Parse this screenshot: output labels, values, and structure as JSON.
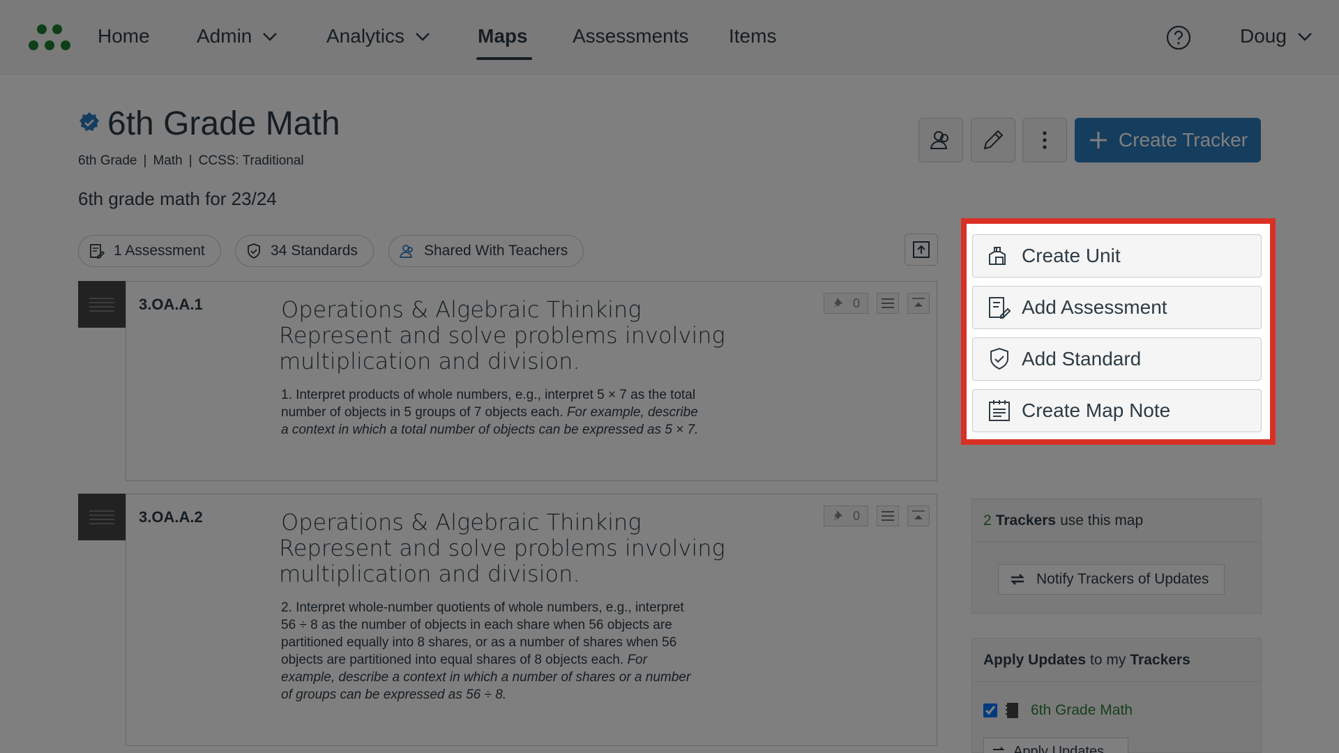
{
  "nav": {
    "items": [
      {
        "label": "Home"
      },
      {
        "label": "Admin"
      },
      {
        "label": "Analytics"
      },
      {
        "label": "Maps"
      },
      {
        "label": "Assessments"
      },
      {
        "label": "Items"
      }
    ],
    "user": "Doug",
    "accent": "#1e7d32"
  },
  "header": {
    "title": "6th Grade Math",
    "grade": "6th Grade",
    "subject": "Math",
    "framework": "CCSS: Traditional",
    "separator": "|",
    "description": "6th grade math for 23/24",
    "create_tracker_label": "Create Tracker"
  },
  "pills": {
    "assessments": "1 Assessment",
    "standards": "34 Standards",
    "shared": "Shared With Teachers"
  },
  "standards": [
    {
      "code": "3.OA.A.1",
      "domain": "Operations & Algebraic Thinking",
      "cluster": "Represent and solve problems involving multiplication and division.",
      "body": "1. Interpret products of whole numbers, e.g., interpret 5 × 7 as the total number of objects in 5 groups of 7 objects each.",
      "example": "For example, describe a context in which a total number of objects can be expressed as 5 × 7.",
      "pins": "0"
    },
    {
      "code": "3.OA.A.2",
      "domain": "Operations & Algebraic Thinking",
      "cluster": "Represent and solve problems involving multiplication and division.",
      "body": "2. Interpret whole-number quotients of whole numbers, e.g., interpret 56 ÷ 8 as the number of objects in each share when 56 objects are partitioned equally into 8 shares, or as a number of shares when 56 objects are partitioned into equal shares of 8 objects each.",
      "example": "For example, describe a context in which a number of shares or a number of groups can be expressed as 56 ÷ 8.",
      "pins": "0"
    }
  ],
  "actions": {
    "create_unit": "Create Unit",
    "add_assessment": "Add Assessment",
    "add_standard": "Add Standard",
    "create_map_note": "Create Map Note",
    "highlight_color": "#d93025"
  },
  "trackers": {
    "count": "2",
    "trackers_word": "Trackers",
    "use_text": "use this map",
    "notify_label": "Notify Trackers of Updates",
    "apply_title": "Apply Updates",
    "apply_to": "to my",
    "apply_trackers": "Trackers",
    "tracker_name": "6th Grade Math",
    "apply_button": "Apply Updates"
  }
}
